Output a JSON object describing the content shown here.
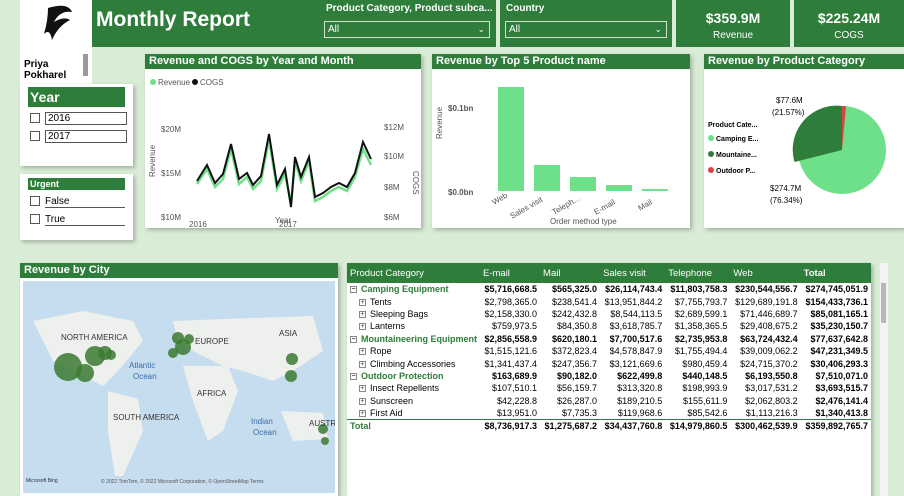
{
  "user": {
    "name_line1": "Priya",
    "name_line2": "Pokharel"
  },
  "header": {
    "title": "Monthly Report"
  },
  "filters": {
    "product_filter": {
      "label": "Product Category, Product subca...",
      "value": "All"
    },
    "country_filter": {
      "label": "Country",
      "value": "All"
    }
  },
  "kpis": [
    {
      "value": "$359.9M",
      "label": "Revenue"
    },
    {
      "value": "$225.24M",
      "label": "COGS"
    }
  ],
  "year_slicer": {
    "title": "Year",
    "options": [
      "2016",
      "2017"
    ]
  },
  "urgent_slicer": {
    "title": "Urgent",
    "options": [
      "False",
      "True"
    ]
  },
  "line_chart": {
    "title": "Revenue and COGS by Year and Month",
    "legend": [
      "Revenue",
      "COGS"
    ],
    "xlabel": "Year",
    "ylabel_left": "Revenue",
    "ylabel_right": "COGS",
    "left_ticks": [
      "$20M",
      "$15M",
      "$10M"
    ],
    "right_ticks": [
      "$12M",
      "$10M",
      "$8M",
      "$6M"
    ],
    "x_ticks": [
      "2016",
      "2017"
    ]
  },
  "bar_chart": {
    "title": "Revenue by Top 5 Product name",
    "ylabel": "Revenue",
    "xlabel": "Order method type",
    "y_ticks": [
      "$0.1bn",
      "$0.0bn"
    ],
    "categories": [
      "Web",
      "Sales visit",
      "Teleph...",
      "E-mail",
      "Mail"
    ]
  },
  "pie_chart": {
    "title": "Revenue by Product Category",
    "legend_title": "Product Cate...",
    "legend": [
      "Camping E...",
      "Mountaine...",
      "Outdoor P..."
    ],
    "label_top": "$77.6M",
    "label_top_pct": "(21.57%)",
    "label_bottom": "$274.7M",
    "label_bottom_pct": "(76.34%)"
  },
  "map": {
    "title": "Revenue by City",
    "labels": [
      "NORTH AMERICA",
      "EUROPE",
      "ASIA",
      "Atlantic",
      "Ocean",
      "AFRICA",
      "SOUTH AMERICA",
      "Indian",
      "Ocean",
      "AUSTR"
    ],
    "footer": "© 2022 TomTom, © 2022 Microsoft Corporation, © OpenStreetMap  Terms",
    "brand": "Microsoft Bing"
  },
  "matrix": {
    "headers": [
      "Product Category",
      "E-mail",
      "Mail",
      "Sales visit",
      "Telephone",
      "Web",
      "Total"
    ],
    "rows": [
      {
        "type": "cat",
        "name": "Camping Equipment",
        "vals": [
          "$5,716,668.5",
          "$565,325.0",
          "$26,114,743.4",
          "$11,803,758.3",
          "$230,544,556.7",
          "$274,745,051.9"
        ]
      },
      {
        "type": "sub",
        "name": "Tents",
        "vals": [
          "$2,798,365.0",
          "$238,541.4",
          "$13,951,844.2",
          "$7,755,793.7",
          "$129,689,191.8",
          "$154,433,736.1"
        ]
      },
      {
        "type": "sub",
        "name": "Sleeping Bags",
        "vals": [
          "$2,158,330.0",
          "$242,432.8",
          "$8,544,113.5",
          "$2,689,599.1",
          "$71,446,689.7",
          "$85,081,165.1"
        ]
      },
      {
        "type": "sub",
        "name": "Lanterns",
        "vals": [
          "$759,973.5",
          "$84,350.8",
          "$3,618,785.7",
          "$1,358,365.5",
          "$29,408,675.2",
          "$35,230,150.7"
        ]
      },
      {
        "type": "cat",
        "name": "Mountaineering Equipment",
        "vals": [
          "$2,856,558.9",
          "$620,180.1",
          "$7,700,517.6",
          "$2,735,953.8",
          "$63,724,432.4",
          "$77,637,642.8"
        ]
      },
      {
        "type": "sub",
        "name": "Rope",
        "vals": [
          "$1,515,121.6",
          "$372,823.4",
          "$4,578,847.9",
          "$1,755,494.4",
          "$39,009,062.2",
          "$47,231,349.5"
        ]
      },
      {
        "type": "sub",
        "name": "Climbing Accessories",
        "vals": [
          "$1,341,437.4",
          "$247,356.7",
          "$3,121,669.6",
          "$980,459.4",
          "$24,715,370.2",
          "$30,406,293.3"
        ]
      },
      {
        "type": "cat",
        "name": "Outdoor Protection",
        "vals": [
          "$163,689.9",
          "$90,182.0",
          "$622,499.8",
          "$440,148.5",
          "$6,193,550.8",
          "$7,510,071.0"
        ]
      },
      {
        "type": "sub",
        "name": "Insect Repellents",
        "vals": [
          "$107,510.1",
          "$56,159.7",
          "$313,320.8",
          "$198,993.9",
          "$3,017,531.2",
          "$3,693,515.7"
        ]
      },
      {
        "type": "sub",
        "name": "Sunscreen",
        "vals": [
          "$42,228.8",
          "$26,287.0",
          "$189,210.5",
          "$155,611.9",
          "$2,062,803.2",
          "$2,476,141.4"
        ]
      },
      {
        "type": "sub",
        "name": "First Aid",
        "vals": [
          "$13,951.0",
          "$7,735.3",
          "$119,968.6",
          "$85,542.6",
          "$1,113,216.3",
          "$1,340,413.8"
        ]
      },
      {
        "type": "tot",
        "name": "Total",
        "vals": [
          "$8,736,917.3",
          "$1,275,687.2",
          "$34,437,760.8",
          "$14,979,860.5",
          "$300,462,539.9",
          "$359,892,765.7"
        ]
      }
    ]
  },
  "colors": {
    "accent": "#2e7d3a",
    "revenue": "#6fe08a",
    "cogs": "#111111",
    "outdoor": "#d64545",
    "background": "#d9ecd6"
  }
}
